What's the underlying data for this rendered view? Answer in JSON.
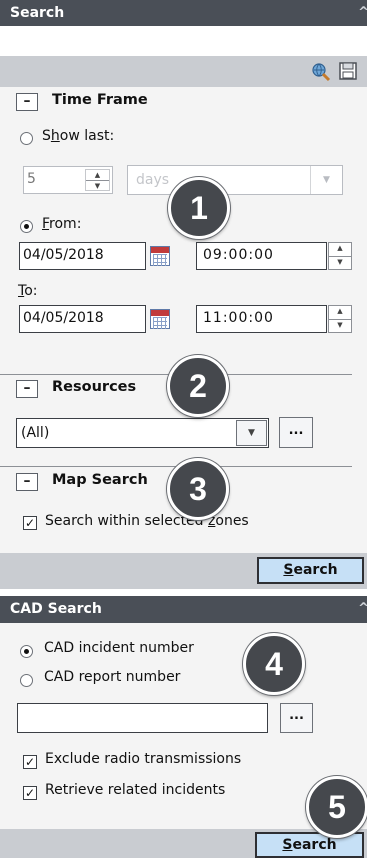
{
  "search_panel": {
    "title": "Search",
    "time_frame": {
      "title": "Time Frame",
      "show_last": {
        "prefix": "S",
        "accel": "h",
        "suffix": "ow last:"
      },
      "show_last_count": "5",
      "show_last_unit": "days",
      "from": {
        "accel": "F",
        "rest": "rom:"
      },
      "from_date": "04/05/2018",
      "from_time": "09:00:00",
      "to": {
        "accel": "T",
        "rest": "o:"
      },
      "to_date": "04/05/2018",
      "to_time": "11:00:00"
    },
    "resources": {
      "title": "Resources",
      "selected": "(All)",
      "browse_label": "..."
    },
    "map_search": {
      "title": "Map Search",
      "within_zones": {
        "prefix": "Search within selected ",
        "accel": "z",
        "suffix": "ones"
      }
    },
    "search_button": {
      "accel": "S",
      "rest": "earch"
    }
  },
  "cad_panel": {
    "title": "CAD Search",
    "incident_number_label": "CAD incident number",
    "report_number_label": "CAD report number",
    "number_value": "",
    "browse_label": "...",
    "exclude_radio_label": "Exclude radio transmissions",
    "retrieve_related_label": "Retrieve related incidents",
    "search_button": {
      "accel": "S",
      "rest": "earch"
    }
  },
  "badges": [
    "1",
    "2",
    "3",
    "4",
    "5"
  ],
  "colors": {
    "titlebar": "#4a4f57",
    "toolbar": "#c9ccd1",
    "panel": "#f4f4f4",
    "search_button": "#c6e0f6",
    "badge": "#45484d"
  },
  "icons": [
    "collapse-up-chevron-icon",
    "find-globe-icon",
    "save-icon",
    "calendar-icon"
  ]
}
